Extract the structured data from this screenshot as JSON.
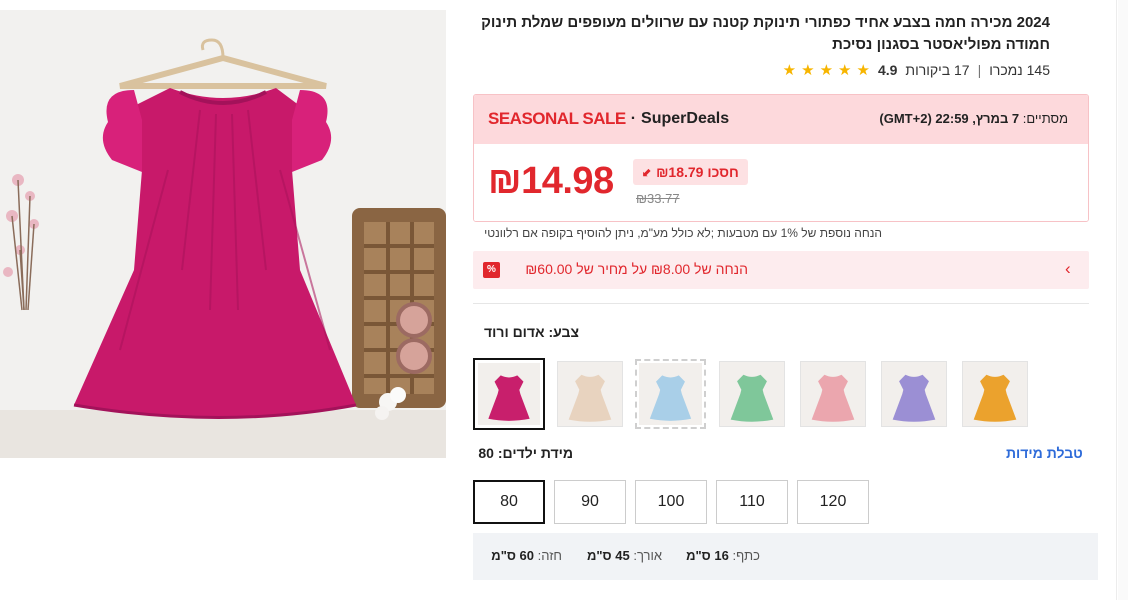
{
  "product": {
    "title": "2024 מכירה חמה בצבע אחיד כפתורי תינוקת קטנה עם שרוולים מעופפים שמלת תינוק חמודה מפוליאסטר בסגנון נסיכת",
    "rating": "4.9",
    "reviews": "17 ביקורות",
    "sold": "145 נמכרו",
    "star_count": 5
  },
  "deal": {
    "seasonal_label": "SEASONAL SALE",
    "dot": "·",
    "superdeals_label": "SuperDeals",
    "ends_prefix": "מסתיים:",
    "ends_time": "7 במרץ, 22:59 (GMT+2)",
    "price": "₪14.98",
    "save_label": "חסכו ₪18.79",
    "original_price": "₪33.77"
  },
  "extra_discount_note": "הנחה נוספת של 1% עם מטבעות ;לא כולל מע\"מ, ניתן להוסיף בקופה אם רלוונטי",
  "coupon": {
    "text": "הנחה של ₪8.00 על מחיר של ₪60.00",
    "icon_text": "%"
  },
  "color": {
    "label": "צבע: אדום ורוד",
    "swatches": [
      {
        "name": "אדום ורוד",
        "color": "#c81f6c",
        "selected": true
      },
      {
        "name": "בז'",
        "color": "#e8d3bf"
      },
      {
        "name": "תכלת",
        "color": "#a9cfe8"
      },
      {
        "name": "ירוק",
        "color": "#7fc79a"
      },
      {
        "name": "ורוד",
        "color": "#eba6ae"
      },
      {
        "name": "סגול",
        "color": "#9b8fd4"
      },
      {
        "name": "צהוב",
        "color": "#eba22d"
      }
    ]
  },
  "size": {
    "label": "מידת ילדים: 80",
    "chart_link": "טבלת מידות",
    "options": [
      "80",
      "90",
      "100",
      "110",
      "120"
    ],
    "selected": "80"
  },
  "measurements": {
    "shoulder_label": "כתף:",
    "shoulder_value": "16 ס\"מ",
    "length_label": "אורך:",
    "length_value": "45 ס\"מ",
    "bust_label": "חזה:",
    "bust_value": "60 ס\"מ"
  }
}
